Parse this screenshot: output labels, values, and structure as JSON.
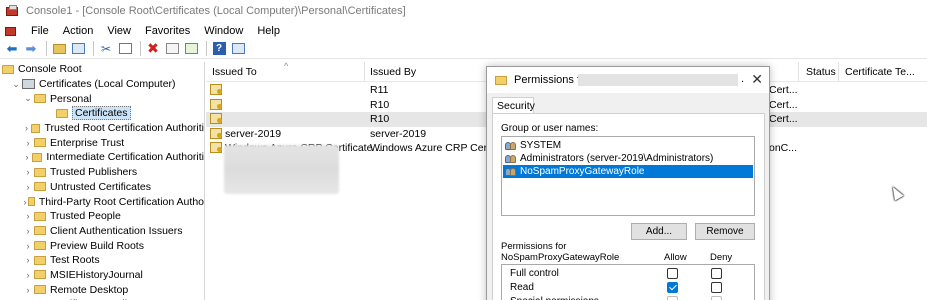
{
  "window": {
    "title": "Console1 - [Console Root\\Certificates (Local Computer)\\Personal\\Certificates]"
  },
  "menu": [
    "File",
    "Action",
    "View",
    "Favorites",
    "Window",
    "Help"
  ],
  "toolbar": {
    "icons": [
      "back-arrow-icon",
      "forward-arrow-icon",
      "up-folder-icon",
      "show-tree-icon",
      "cut-icon",
      "copy-icon",
      "delete-icon",
      "properties-icon",
      "export-icon",
      "help-icon",
      "console-tree-icon"
    ],
    "help_glyph": "?"
  },
  "tree": {
    "items": [
      {
        "label": "Console Root",
        "depth": 0,
        "chev": "",
        "icon": "folder"
      },
      {
        "label": "Certificates (Local Computer)",
        "depth": 1,
        "chev": "⌄",
        "icon": "computer"
      },
      {
        "label": "Personal",
        "depth": 2,
        "chev": "⌄",
        "icon": "folder"
      },
      {
        "label": "Certificates",
        "depth": 3,
        "chev": "",
        "icon": "folder",
        "selected": true
      },
      {
        "label": "Trusted Root Certification Authoriti",
        "depth": 2,
        "chev": "›",
        "icon": "folder"
      },
      {
        "label": "Enterprise Trust",
        "depth": 2,
        "chev": "›",
        "icon": "folder"
      },
      {
        "label": "Intermediate Certification Authoriti",
        "depth": 2,
        "chev": "›",
        "icon": "folder"
      },
      {
        "label": "Trusted Publishers",
        "depth": 2,
        "chev": "›",
        "icon": "folder"
      },
      {
        "label": "Untrusted Certificates",
        "depth": 2,
        "chev": "›",
        "icon": "folder"
      },
      {
        "label": "Third-Party Root Certification Autho",
        "depth": 2,
        "chev": "›",
        "icon": "folder"
      },
      {
        "label": "Trusted People",
        "depth": 2,
        "chev": "›",
        "icon": "folder"
      },
      {
        "label": "Client Authentication Issuers",
        "depth": 2,
        "chev": "›",
        "icon": "folder"
      },
      {
        "label": "Preview Build Roots",
        "depth": 2,
        "chev": "›",
        "icon": "folder"
      },
      {
        "label": "Test Roots",
        "depth": 2,
        "chev": "›",
        "icon": "folder"
      },
      {
        "label": "MSIEHistoryJournal",
        "depth": 2,
        "chev": "›",
        "icon": "folder"
      },
      {
        "label": "Remote Desktop",
        "depth": 2,
        "chev": "›",
        "icon": "folder"
      },
      {
        "label": "Certificate Enrollment Requests",
        "depth": 2,
        "chev": "›",
        "icon": "folder"
      }
    ]
  },
  "list": {
    "columns": [
      "Issued To",
      "Issued By",
      "Status",
      "Certificate Te..."
    ],
    "rows": [
      {
        "issued_to": "",
        "issued_by": "R11",
        "tail": "Cert..."
      },
      {
        "issued_to": "",
        "issued_by": "R10",
        "tail": "Cert..."
      },
      {
        "issued_to": "",
        "issued_by": "R10",
        "tail": "Cert..."
      },
      {
        "issued_to": "server-2019",
        "issued_by": "server-2019",
        "tail": ""
      },
      {
        "issued_to": "Windows Azure CRP Certificate ...",
        "issued_by": "Windows Azure CRP Certifi",
        "tail": "onC..."
      }
    ]
  },
  "dialog": {
    "title": "Permissions for",
    "title_dot": ".",
    "close_glyph": "✕",
    "tab": "Security",
    "group_label": "Group or user names:",
    "users": [
      {
        "name": "SYSTEM",
        "selected": false
      },
      {
        "name": "Administrators (server-2019\\Administrators)",
        "selected": false
      },
      {
        "name": "NoSpamProxyGatewayRole",
        "selected": true
      }
    ],
    "add_label": "Add...",
    "remove_label": "Remove",
    "perm_label_line1": "Permissions for",
    "perm_label_line2": "NoSpamProxyGatewayRole",
    "allow_label": "Allow",
    "deny_label": "Deny",
    "permissions": [
      {
        "name": "Full control",
        "allow": false,
        "deny": false
      },
      {
        "name": "Read",
        "allow": true,
        "deny": false
      },
      {
        "name": "Special permissions",
        "allow": false,
        "deny": false
      }
    ]
  },
  "colors": {
    "selection": "#0078d7",
    "folder": "#f3cf6b",
    "delete": "#d12020"
  }
}
